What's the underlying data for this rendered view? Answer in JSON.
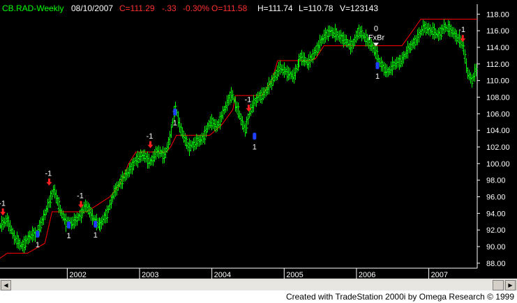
{
  "header": {
    "symbol": "CB.RAD-Weekly",
    "date": "08/10/2007",
    "close": "C=111.29",
    "change": "-.33",
    "pct": "-0.30%",
    "open": "O=111.58",
    "high": "H=111.74",
    "low": "L=110.78",
    "volume": "V=123143"
  },
  "footer": {
    "credit": "Created with TradeStation 2000i by Omega Research © 1999"
  },
  "colors": {
    "bars": "#00ff00",
    "stop": "#ff0000",
    "sell_arrow": "#ff2020",
    "buy_marker": "#2040ff",
    "axis": "#ffffff",
    "background": "#000000",
    "header_symbol": "#00ff00",
    "header_text": "#ffffff",
    "header_change": "#ff3030"
  },
  "chart_data": {
    "type": "line",
    "xlim": [
      2001.0,
      2007.6
    ],
    "ylim": [
      87.4,
      119.2
    ],
    "yticks": [
      88,
      90,
      92,
      94,
      96,
      98,
      100,
      102,
      104,
      106,
      108,
      110,
      112,
      114,
      116,
      118
    ],
    "ytick_labels": [
      "88.00",
      "90.00",
      "92.00",
      "94.00",
      "96.00",
      "98.00",
      "100.00",
      "102.00",
      "104.00",
      "106.00",
      "108.00",
      "110.00",
      "112.00",
      "114.00",
      "116.00",
      "118.00"
    ],
    "xticks": [
      2001.93,
      2002.93,
      2003.93,
      2004.93,
      2005.93,
      2006.93
    ],
    "xtick_labels": [
      "2002",
      "2003",
      "2004",
      "2005",
      "2006",
      "2007"
    ],
    "series": [
      {
        "style": "price_bars",
        "x": [
          2001.0,
          2001.1,
          2001.2,
          2001.3,
          2001.4,
          2001.5,
          2001.6,
          2001.68,
          2001.74,
          2001.82,
          2001.9,
          2002.0,
          2002.1,
          2002.18,
          2002.28,
          2002.38,
          2002.48,
          2002.58,
          2002.68,
          2002.78,
          2002.88,
          2002.98,
          2003.08,
          2003.18,
          2003.28,
          2003.36,
          2003.42,
          2003.5,
          2003.6,
          2003.7,
          2003.8,
          2003.9,
          2004.0,
          2004.1,
          2004.2,
          2004.3,
          2004.38,
          2004.46,
          2004.56,
          2004.66,
          2004.76,
          2004.86,
          2004.96,
          2005.06,
          2005.16,
          2005.26,
          2005.36,
          2005.46,
          2005.56,
          2005.66,
          2005.76,
          2005.86,
          2005.96,
          2006.06,
          2006.16,
          2006.26,
          2006.36,
          2006.46,
          2006.56,
          2006.66,
          2006.76,
          2006.86,
          2006.96,
          2007.06,
          2007.14,
          2007.24,
          2007.34,
          2007.4,
          2007.46,
          2007.52,
          2007.58
        ],
        "y": [
          92.5,
          93.2,
          91.0,
          90.0,
          91.2,
          91.6,
          93.5,
          95.5,
          97.0,
          94.5,
          93.0,
          92.8,
          93.8,
          95.0,
          93.5,
          92.5,
          94.0,
          96.5,
          98.0,
          99.0,
          100.5,
          101.0,
          100.2,
          101.5,
          101.0,
          103.5,
          107.0,
          104.0,
          102.0,
          102.5,
          103.0,
          105.0,
          104.5,
          106.5,
          108.5,
          106.0,
          104.0,
          106.5,
          108.0,
          108.5,
          110.0,
          111.5,
          111.0,
          110.5,
          113.0,
          112.0,
          113.5,
          115.0,
          116.0,
          115.5,
          115.0,
          114.0,
          116.0,
          115.0,
          114.0,
          112.0,
          111.0,
          112.0,
          112.5,
          114.0,
          115.0,
          116.5,
          116.0,
          115.5,
          116.5,
          116.0,
          115.0,
          114.0,
          111.0,
          110.0,
          111.3
        ]
      },
      {
        "style": "stop_line",
        "x": [
          2001.0,
          2001.1,
          2001.38,
          2001.62,
          2001.72,
          2002.04,
          2002.2,
          2002.52,
          2002.66,
          2002.78,
          2002.88,
          2003.0,
          2003.3,
          2003.36,
          2003.44,
          2003.9,
          2004.06,
          2004.22,
          2004.26,
          2004.62,
          2004.76,
          2004.84,
          2005.04,
          2005.28,
          2005.36,
          2005.48,
          2005.62,
          2006.16,
          2006.2,
          2006.56,
          2006.74,
          2006.82,
          2007.6
        ],
        "y": [
          88.6,
          89.2,
          89.2,
          90.4,
          94.2,
          94.2,
          94.2,
          96.0,
          97.5,
          100.0,
          101.4,
          101.4,
          101.4,
          102.0,
          103.4,
          103.4,
          104.6,
          106.5,
          108.2,
          108.2,
          110.0,
          112.4,
          112.4,
          112.4,
          112.6,
          114.2,
          114.2,
          114.2,
          114.2,
          114.2,
          116.4,
          117.4,
          117.4
        ]
      }
    ],
    "annotations": [
      {
        "kind": "sell",
        "x": 2001.04,
        "y": 93.5,
        "text": "-1"
      },
      {
        "kind": "buy",
        "x": 2001.52,
        "y": 91.5,
        "text": "1"
      },
      {
        "kind": "sell",
        "x": 2001.68,
        "y": 97.1,
        "text": "-1"
      },
      {
        "kind": "buy",
        "x": 2001.95,
        "y": 92.6,
        "text": "1"
      },
      {
        "kind": "sell",
        "x": 2002.12,
        "y": 94.4,
        "text": "-1"
      },
      {
        "kind": "buy",
        "x": 2002.32,
        "y": 92.7,
        "text": "1"
      },
      {
        "kind": "sell",
        "x": 2003.08,
        "y": 101.6,
        "text": "-1"
      },
      {
        "kind": "buy",
        "x": 2003.42,
        "y": 106.2,
        "text": "1"
      },
      {
        "kind": "sell",
        "x": 2004.44,
        "y": 106.0,
        "text": "-1"
      },
      {
        "kind": "buy",
        "x": 2004.52,
        "y": 103.3,
        "text": "1"
      },
      {
        "kind": "exit",
        "x": 2006.2,
        "y": 113.8,
        "text": "0",
        "label": "FxBr"
      },
      {
        "kind": "buy",
        "x": 2006.22,
        "y": 111.8,
        "text": "1"
      },
      {
        "kind": "sell",
        "x": 2007.4,
        "y": 114.4,
        "text": "-1"
      }
    ]
  }
}
